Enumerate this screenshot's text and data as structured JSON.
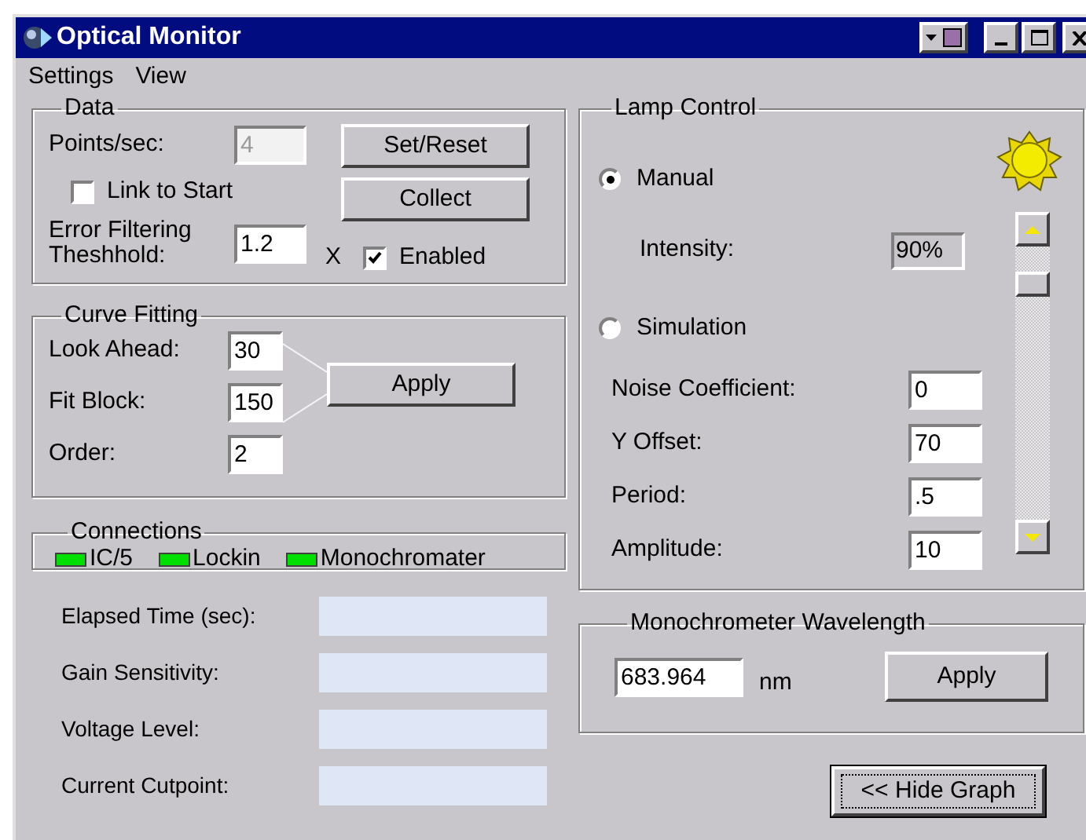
{
  "window": {
    "title": "Optical Monitor"
  },
  "menu": [
    "Settings",
    "View"
  ],
  "data": {
    "title": "Data",
    "points_label": "Points/sec:",
    "points_value": "4",
    "points_disabled": true,
    "set_reset": "Set/Reset",
    "collect": "Collect",
    "link": {
      "label": "Link to Start",
      "checked": false
    },
    "threshold_label": "Error Filtering Theshhold:",
    "threshold_value": "1.2",
    "threshold_unit": "X",
    "enabled": {
      "label": "Enabled",
      "checked": true
    }
  },
  "curve_fitting": {
    "title": "Curve Fitting",
    "fields": [
      {
        "label": "Look Ahead:",
        "value": "30"
      },
      {
        "label": "Fit Block:",
        "value": "150"
      },
      {
        "label": "Order:",
        "value": "2"
      }
    ],
    "apply": "Apply"
  },
  "connections": {
    "title": "Connections",
    "items": [
      {
        "label": "IC/5",
        "on": true
      },
      {
        "label": "Lockin",
        "on": true
      },
      {
        "label": "Monochromater",
        "on": true
      }
    ]
  },
  "readouts": [
    {
      "label": "Elapsed Time (sec):"
    },
    {
      "label": "Gain Sensitivity:"
    },
    {
      "label": "Voltage Level:"
    },
    {
      "label": "Current Cutpoint:"
    }
  ],
  "lamp_control": {
    "title": "Lamp Control",
    "modes": [
      {
        "label": "Manual",
        "selected": true
      },
      {
        "label": "Simulation",
        "selected": false
      }
    ],
    "intensity_label": "Intensity:",
    "intensity_value": "90%",
    "slider": {
      "level": 0.9
    },
    "sim_fields": [
      {
        "label": "Noise Coefficient:",
        "value": "0"
      },
      {
        "label": "Y Offset:",
        "value": "70"
      },
      {
        "label": "Period:",
        "value": ".5"
      },
      {
        "label": "Amplitude:",
        "value": "10"
      }
    ]
  },
  "wavelength": {
    "title": "Monochrometer Wavelength",
    "value": "683.964",
    "unit": "nm",
    "apply": "Apply"
  },
  "hide_graph": "<< Hide Graph"
}
